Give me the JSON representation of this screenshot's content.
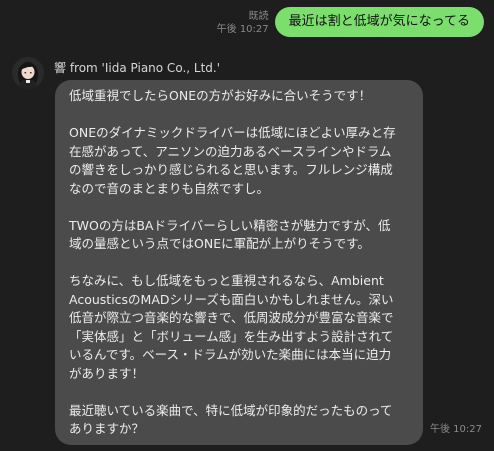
{
  "outgoing": {
    "read_label": "既読",
    "time": "午後 10:27",
    "text": "最近は割と低域が気になってる"
  },
  "incoming": {
    "sender": "響 from 'Iida Piano Co., Ltd.'",
    "time": "午後 10:27",
    "paragraphs": [
      "低域重視でしたらONEの方がお好みに合いそうです！",
      "ONEのダイナミックドライバーは低域にほどよい厚みと存\n在感があって、アニソンの迫力あるベースラインやドラム\nの響きをしっかり感じられると思います。フルレンジ構成\nなので音のまとまりも自然ですし。",
      "TWOの方はBAドライバーらしい精密さが魅力ですが、低\n域の量感という点ではONEに軍配が上がりそうです。",
      "ちなみに、もし低域をもっと重視されるなら、Ambient\nAcousticsのMADシリーズも面白いかもしれません。深い\n低音が際立つ音楽的な響きで、低周波成分が豊富な音楽で\n「実体感」と「ボリューム感」を生み出すよう設計されて\nいるんです。ベース・ドラムが効いた楽曲には本当に迫力\nがあります！",
      "最近聴いている楽曲で、特に低域が印象的だったものって\nありますか？"
    ]
  },
  "colors": {
    "background": "#1e1e1e",
    "outgoing_bubble": "#7cde6c",
    "incoming_bubble": "#4b4b4b",
    "meta_text": "#8a8a8a"
  }
}
